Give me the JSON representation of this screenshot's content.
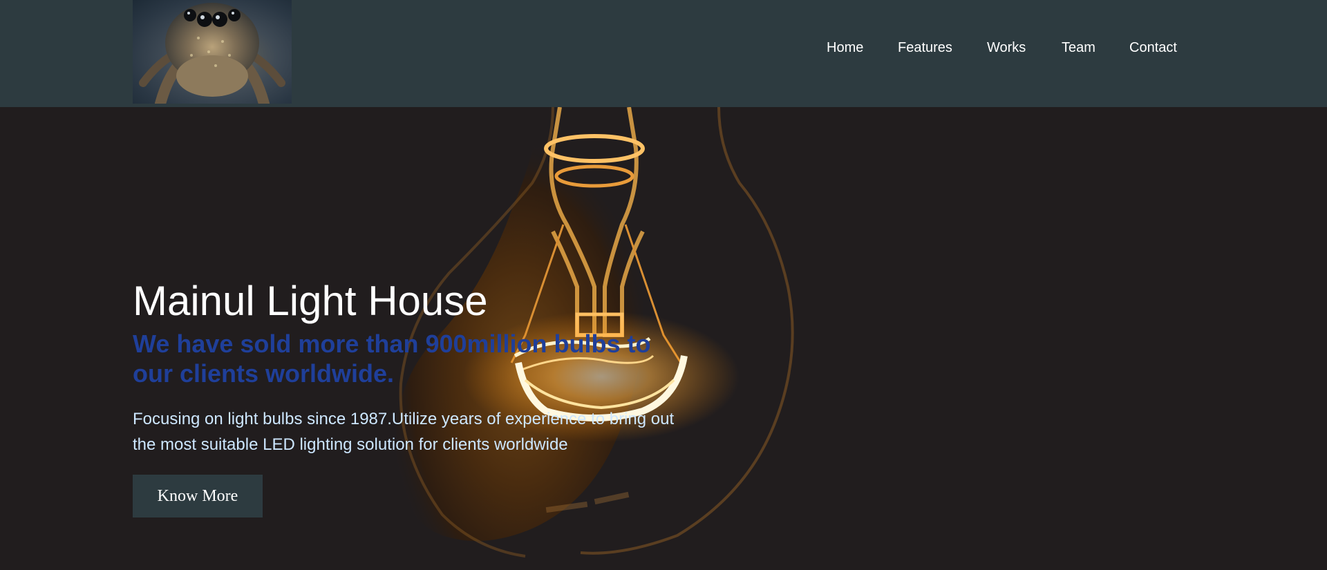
{
  "header": {
    "logo_alt": "spider logo",
    "nav": [
      {
        "label": "Home"
      },
      {
        "label": "Features"
      },
      {
        "label": "Works"
      },
      {
        "label": "Team"
      },
      {
        "label": "Contact"
      }
    ]
  },
  "hero": {
    "title": "Mainul Light House",
    "subtitle": "We have sold more than 900million bulbs to our clients worldwide.",
    "description": "Focusing on light bulbs since 1987.Utilize years of experience to bring out the most suitable LED lighting solution for clients worldwide",
    "button_label": "Know More"
  },
  "colors": {
    "navbar_bg": "#2d3b40",
    "hero_bg": "#211d1e",
    "subtitle": "#1f3f9a",
    "description": "#cde7ff",
    "glow": "#ffb347"
  },
  "icons": {
    "logo": "jumping-spider-photo",
    "hero_image": "light-bulb-photo"
  }
}
